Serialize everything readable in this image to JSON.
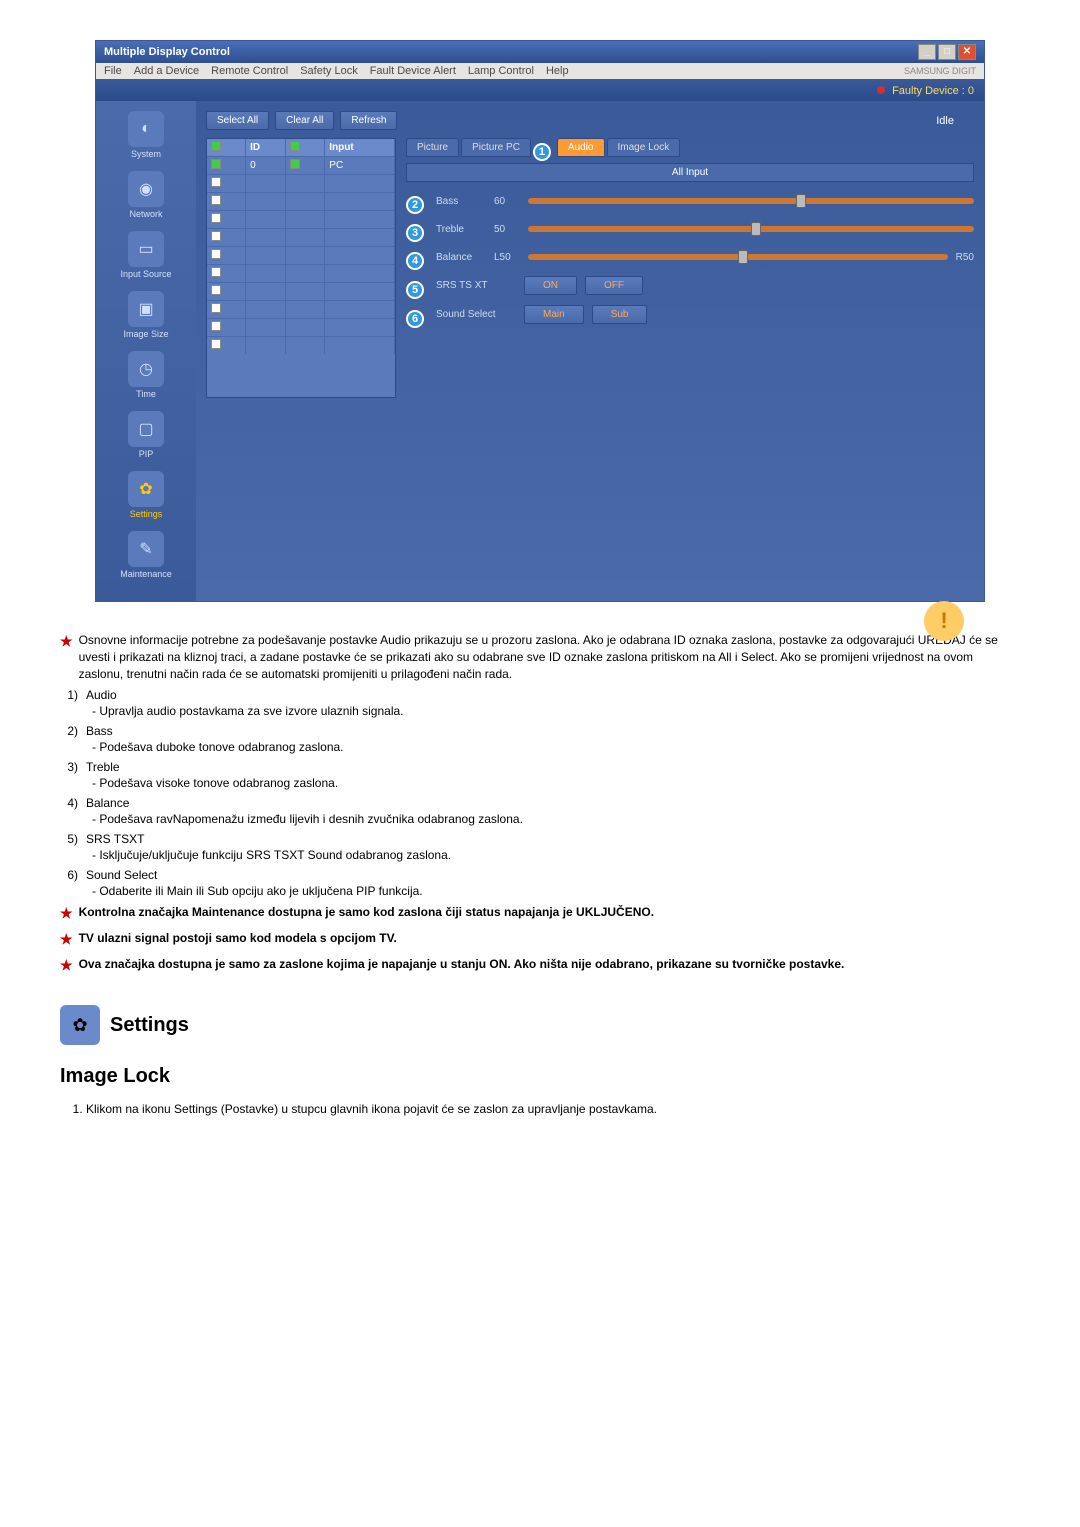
{
  "screenshot": {
    "title": "Multiple Display Control",
    "menu": [
      "File",
      "Add a Device",
      "Remote Control",
      "Safety Lock",
      "Fault Device Alert",
      "Lamp Control",
      "Help"
    ],
    "brand": "SAMSUNG DIGIT",
    "faulty_label": "Faulty Device : 0",
    "sidebar": {
      "items": [
        {
          "label": "System",
          "icon": "◐"
        },
        {
          "label": "Network",
          "icon": "◉"
        },
        {
          "label": "Input Source",
          "icon": "▭"
        },
        {
          "label": "Image Size",
          "icon": "▣"
        },
        {
          "label": "Time",
          "icon": "◷"
        },
        {
          "label": "PIP",
          "icon": "▢"
        },
        {
          "label": "Settings",
          "icon": "✿"
        },
        {
          "label": "Maintenance",
          "icon": "✎"
        }
      ]
    },
    "buttons": {
      "select_all": "Select All",
      "clear_all": "Clear All",
      "refresh": "Refresh"
    },
    "idle": "Idle",
    "tabs": {
      "picture": "Picture",
      "picture_pc": "Picture PC",
      "audio": "Audio",
      "image_lock": "Image Lock"
    },
    "table": {
      "headers": [
        "",
        "ID",
        "",
        "Input"
      ],
      "rows": [
        [
          "✓",
          "0",
          "●",
          "PC"
        ]
      ]
    },
    "all_input": "All Input",
    "sliders": {
      "bass": {
        "label": "Bass",
        "val": "60"
      },
      "treble": {
        "label": "Treble",
        "val": "50"
      },
      "balance": {
        "label": "Balance",
        "val": "L50",
        "right": "R50"
      }
    },
    "srs": {
      "label": "SRS TS XT",
      "on": "ON",
      "off": "OFF"
    },
    "sound_select": {
      "label": "Sound Select",
      "main": "Main",
      "sub": "Sub"
    },
    "callouts": [
      "1",
      "2",
      "3",
      "4",
      "5",
      "6"
    ]
  },
  "doc": {
    "intro": "Osnovne informacije potrebne za podešavanje postavke Audio prikazuju se u prozoru zaslona. Ako je odabrana ID oznaka zaslona, postavke za odgovarajući UREĐAJ će se uvesti i prikazati na kliznoj traci, a zadane postavke će se prikazati ako su odabrane sve ID oznake zaslona pritiskom na All i Select. Ako se promijeni vrijednost na ovom zaslonu, trenutni način rada će se automatski promijeniti u prilagođeni način rada.",
    "items": [
      {
        "n": "1)",
        "t": "Audio",
        "d": "- Upravlja audio postavkama za sve izvore ulaznih signala."
      },
      {
        "n": "2)",
        "t": "Bass",
        "d": "- Podešava duboke tonove odabranog zaslona."
      },
      {
        "n": "3)",
        "t": "Treble",
        "d": "- Podešava visoke tonove odabranog zaslona."
      },
      {
        "n": "4)",
        "t": "Balance",
        "d": "- Podešava ravNapomenažu između lijevih i desnih zvučnika odabranog zaslona."
      },
      {
        "n": "5)",
        "t": "SRS TSXT",
        "d": "- Isključuje/uključuje funkciju SRS TSXT Sound odabranog zaslona."
      },
      {
        "n": "6)",
        "t": "Sound Select",
        "d": "- Odaberite ili Main ili Sub opciju ako je uključena PIP funkcija."
      }
    ],
    "notes": [
      "Kontrolna značajka Maintenance dostupna je samo kod zaslona čiji status napajanja je UKLJUČENO.",
      "TV ulazni signal postoji samo kod modela s opcijom TV.",
      "Ova značajka dostupna je samo za zaslone kojima je napajanje u stanju ON. Ako ništa nije odabrano, prikazane su tvorničke postavke."
    ],
    "settings_heading": "Settings",
    "image_lock_heading": "Image Lock",
    "image_lock_step": "Klikom na ikonu Settings (Postavke) u stupcu glavnih ikona pojavit će se zaslon za upravljanje postavkama."
  }
}
